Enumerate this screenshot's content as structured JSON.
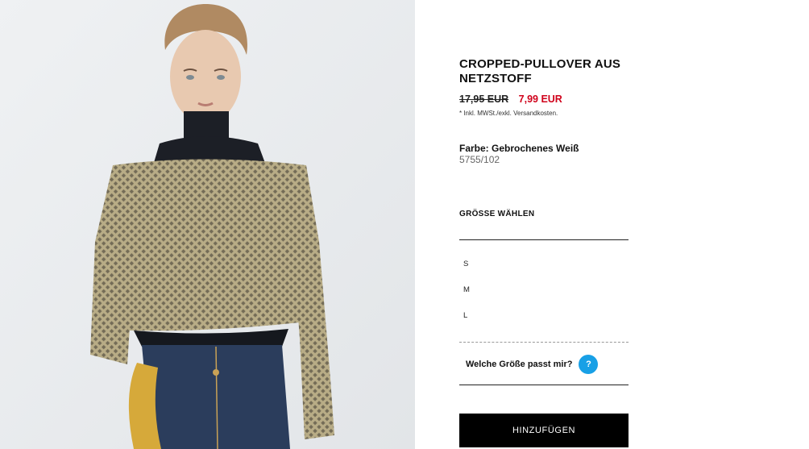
{
  "product": {
    "title": "CROPPED-PULLOVER AUS NETZSTOFF",
    "price_old": "17,95 EUR",
    "price_new": "7,99 EUR",
    "tax_note": "* Inkl. MWSt./exkl. Versandkosten.",
    "color_label": "Farbe: Gebrochenes Weiß",
    "sku": "5755/102"
  },
  "sizes": {
    "heading": "GRÖSSE WÄHLEN",
    "options": [
      "S",
      "M",
      "L"
    ],
    "help_text": "Welche Größe passt mir?",
    "help_icon": "?"
  },
  "actions": {
    "add_label": "HINZUFÜGEN"
  },
  "colors": {
    "sale_price": "#d0021b",
    "help_icon_bg": "#18a0e6",
    "button_bg": "#000000"
  }
}
